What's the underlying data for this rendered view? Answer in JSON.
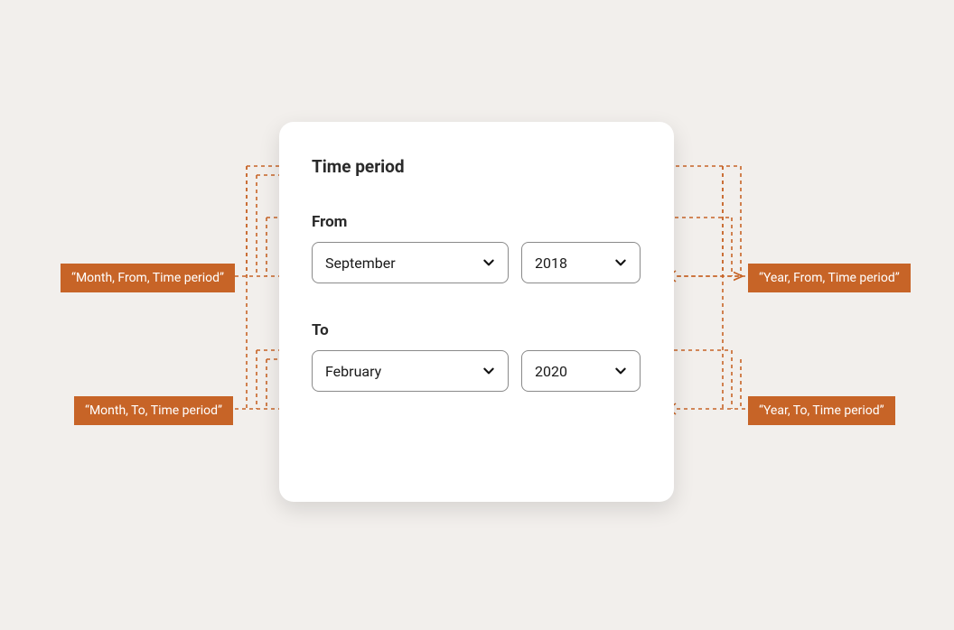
{
  "card": {
    "title": "Time period",
    "from": {
      "label": "From",
      "month": "September",
      "year": "2018"
    },
    "to": {
      "label": "To",
      "month": "February",
      "year": "2020"
    }
  },
  "annotations": {
    "month_from": "“Month, From, Time period”",
    "year_from": "“Year, From, Time period”",
    "month_to": "“Month, To, Time period”",
    "year_to": "“Year, To, Time period”"
  },
  "colors": {
    "badge": "#c76427",
    "card_bg": "#ffffff",
    "page_bg": "#f2efec"
  }
}
